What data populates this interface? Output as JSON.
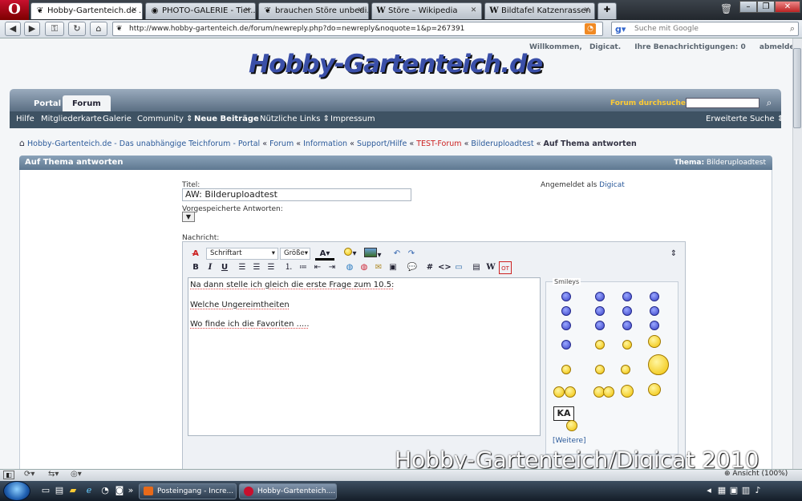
{
  "browser": {
    "logo": "O",
    "tabs": [
      {
        "label": "Hobby-Gartenteich.de ...",
        "icon": "fish-icon",
        "active": true
      },
      {
        "label": "PHOTO-GALERIE - Tier...",
        "icon": "globe-icon",
        "active": false
      },
      {
        "label": "brauchen Störe unbedi...",
        "icon": "fish-icon",
        "active": false
      },
      {
        "label": "Störe – Wikipedia",
        "icon": "wikipedia-icon",
        "active": false
      },
      {
        "label": "Bildtafel Katzenrassen ...",
        "icon": "wikipedia-icon",
        "active": false
      }
    ],
    "url": "http://www.hobby-gartenteich.de/forum/newreply.php?do=newreply&noquote=1&p=267391",
    "search_placeholder": "Suche mit Google",
    "zoom": "Ansicht (100%)"
  },
  "site": {
    "welcome": "Willkommen,",
    "user": "Digicat.",
    "notifications": "Ihre Benachrichtigungen: 0",
    "logout": "abmelden",
    "logo": "Hobby-Gartenteich.de",
    "tabs": {
      "portal": "Portal",
      "forum": "Forum"
    },
    "forum_search": "Forum durchsuchen",
    "nav": {
      "hilfe": "Hilfe",
      "mitglieder": "Mitgliederkarte",
      "galerie": "Galerie",
      "community": "Community",
      "neue": "Neue Beiträge",
      "links": "Nützliche Links",
      "impressum": "Impressum",
      "erweitert": "Erweiterte Suche"
    },
    "breadcrumb": {
      "home": "Hobby-Gartenteich.de - Das unabhängige Teichforum - Portal",
      "sep": "«",
      "forum": "Forum",
      "info": "Information",
      "support": "Support/Hilfe",
      "test": "TEST-Forum",
      "bildupload": "Bilderuploadtest",
      "current": "Auf Thema antworten"
    }
  },
  "form": {
    "panel_title": "Auf Thema antworten",
    "thema_label": "Thema:",
    "thema_value": "Bilderuploadtest",
    "titel_label": "Titel:",
    "titel_value": "AW: Bilderuploadtest",
    "logged_in_label": "Angemeldet als",
    "logged_in_user": "Digicat",
    "preset_label": "Vorgespeicherte Antworten:",
    "nachricht_label": "Nachricht:",
    "font_select": "Schriftart",
    "size_select": "Größe",
    "message_lines": [
      "Na dann stelle ich gleich die erste Frage zum 10.5:",
      "Welche Ungereimtheiten",
      "Wo finde ich die Favoriten ....."
    ],
    "smilies_title": "Smileys",
    "smilies_more": "[Weitere]",
    "ka_label": "KA"
  },
  "watermark": "Hobby-Gartenteich/Digicat 2010",
  "taskbar": {
    "tasks": [
      {
        "label": "Posteingang - Incre...",
        "icon": "mail-icon"
      },
      {
        "label": "Hobby-Gartenteich....",
        "icon": "opera-icon"
      }
    ]
  },
  "colors": {
    "nav_dark": "#3e5263",
    "link": "#2b5a9a",
    "accent_yellow": "#ffcc33"
  }
}
